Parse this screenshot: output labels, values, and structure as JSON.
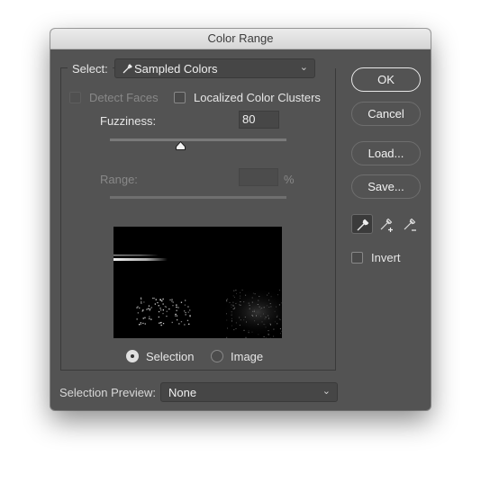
{
  "window": {
    "title": "Color Range"
  },
  "select": {
    "label": "Select:",
    "value": "Sampled Colors",
    "icon": "eyedropper-icon"
  },
  "detect_faces": {
    "label": "Detect Faces",
    "checked": false,
    "enabled": false
  },
  "localized_clusters": {
    "label": "Localized Color Clusters",
    "checked": false
  },
  "fuzziness": {
    "label": "Fuzziness:",
    "value": "80",
    "slider_fraction": 0.4
  },
  "range": {
    "label": "Range:",
    "value": "",
    "unit": "%",
    "enabled": false
  },
  "preview_mode": {
    "options": [
      {
        "label": "Selection",
        "selected": true
      },
      {
        "label": "Image",
        "selected": false
      }
    ]
  },
  "selection_preview": {
    "label": "Selection Preview:",
    "value": "None"
  },
  "buttons": {
    "ok": "OK",
    "cancel": "Cancel",
    "load": "Load...",
    "save": "Save..."
  },
  "tools": [
    {
      "name": "eyedropper-icon",
      "active": true
    },
    {
      "name": "eyedropper-plus-icon",
      "active": false
    },
    {
      "name": "eyedropper-minus-icon",
      "active": false
    }
  ],
  "invert": {
    "label": "Invert",
    "checked": false
  }
}
